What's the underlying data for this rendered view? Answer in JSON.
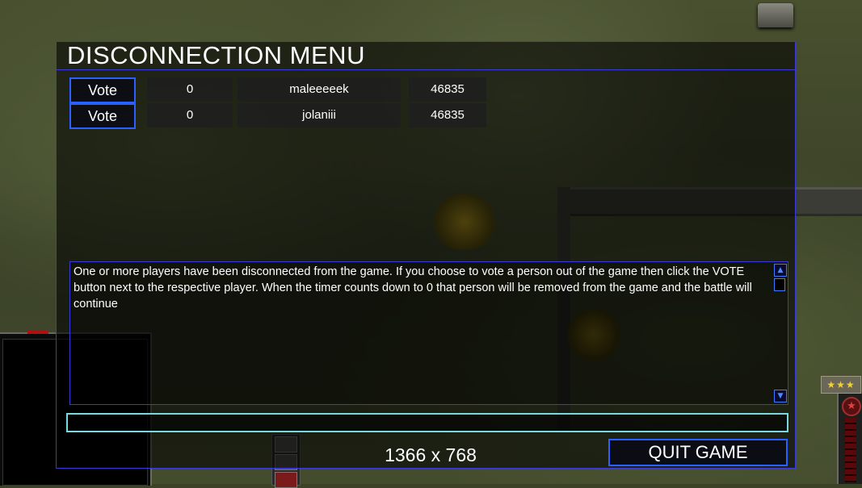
{
  "dialog": {
    "title": "DISCONNECTION MENU",
    "players": [
      {
        "vote_label": "Vote",
        "count": "0",
        "name": "maleeeeek",
        "ping": "46835"
      },
      {
        "vote_label": "Vote",
        "count": "0",
        "name": "jolaniii",
        "ping": "46835"
      }
    ],
    "message": "One or more players have been disconnected from the game. If you choose to vote a person out of the game then click the VOTE button next to the respective player. When the timer counts down to 0 that person will be removed from the game and the battle will continue",
    "chat_value": "",
    "resolution": "1366 x 768",
    "quit_label": "QUIT GAME"
  },
  "hud": {
    "rank_stars": "★★★",
    "general_icon": "star-emblem-icon"
  },
  "colors": {
    "dialog_border": "#3a3ad8",
    "button_border": "#2a60ff",
    "input_border": "#7ad8e0",
    "text": "#ffffff"
  }
}
